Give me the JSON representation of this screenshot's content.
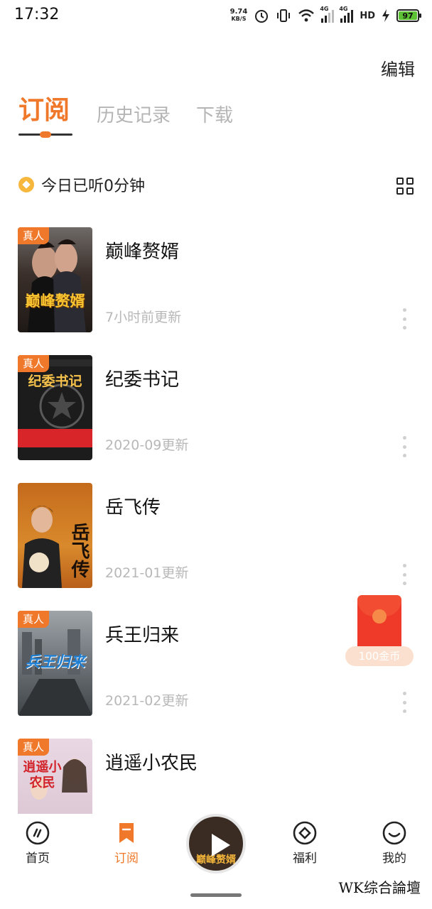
{
  "status_bar": {
    "time": "17:32",
    "net_speed": "9.74",
    "net_unit": "KB/S",
    "network_tag_1": "4G",
    "network_tag_2": "4G",
    "hd": "HD",
    "battery": "97",
    "icons": [
      "alarm-icon",
      "vibrate-icon",
      "wifi-icon",
      "signal-icon",
      "signal-icon",
      "hd-icon",
      "charging-icon",
      "battery-icon"
    ]
  },
  "header": {
    "edit_label": "编辑",
    "tabs": [
      {
        "label": "订阅",
        "active": true
      },
      {
        "label": "历史记录",
        "active": false
      },
      {
        "label": "下载",
        "active": false
      }
    ]
  },
  "listen_summary": {
    "text": "今日已听0分钟",
    "icons": [
      "coin-icon",
      "grid-view-icon"
    ]
  },
  "books": [
    {
      "title": "巅峰赘婿",
      "update": "7小时前更新",
      "badge": "真人",
      "cover_text": "巅峰赘婿"
    },
    {
      "title": "纪委书记",
      "update": "2020-09更新",
      "badge": "真人",
      "cover_text": "纪委书记"
    },
    {
      "title": "岳飞传",
      "update": "2021-01更新",
      "badge": "",
      "cover_text": "岳飞传"
    },
    {
      "title": "兵王归来",
      "update": "2021-02更新",
      "badge": "真人",
      "cover_text": "兵王归来"
    },
    {
      "title": "逍遥小农民",
      "update": "",
      "badge": "真人",
      "cover_text": "逍遥小农民"
    }
  ],
  "red_packet": {
    "label": "100金币"
  },
  "bottom_nav": {
    "items": [
      {
        "label": "首页",
        "icon": "home-icon",
        "active": false
      },
      {
        "label": "订阅",
        "icon": "bookmark-icon",
        "active": true
      },
      {
        "label": "福利",
        "icon": "welfare-icon",
        "active": false
      },
      {
        "label": "我的",
        "icon": "smile-icon",
        "active": false
      }
    ],
    "player_cover_text": "巅峰赘婿"
  },
  "watermark": "WK综合論壇",
  "colors": {
    "accent": "#f0782a",
    "muted": "#b8b8b8",
    "red_packet": "#ef3a2a"
  }
}
